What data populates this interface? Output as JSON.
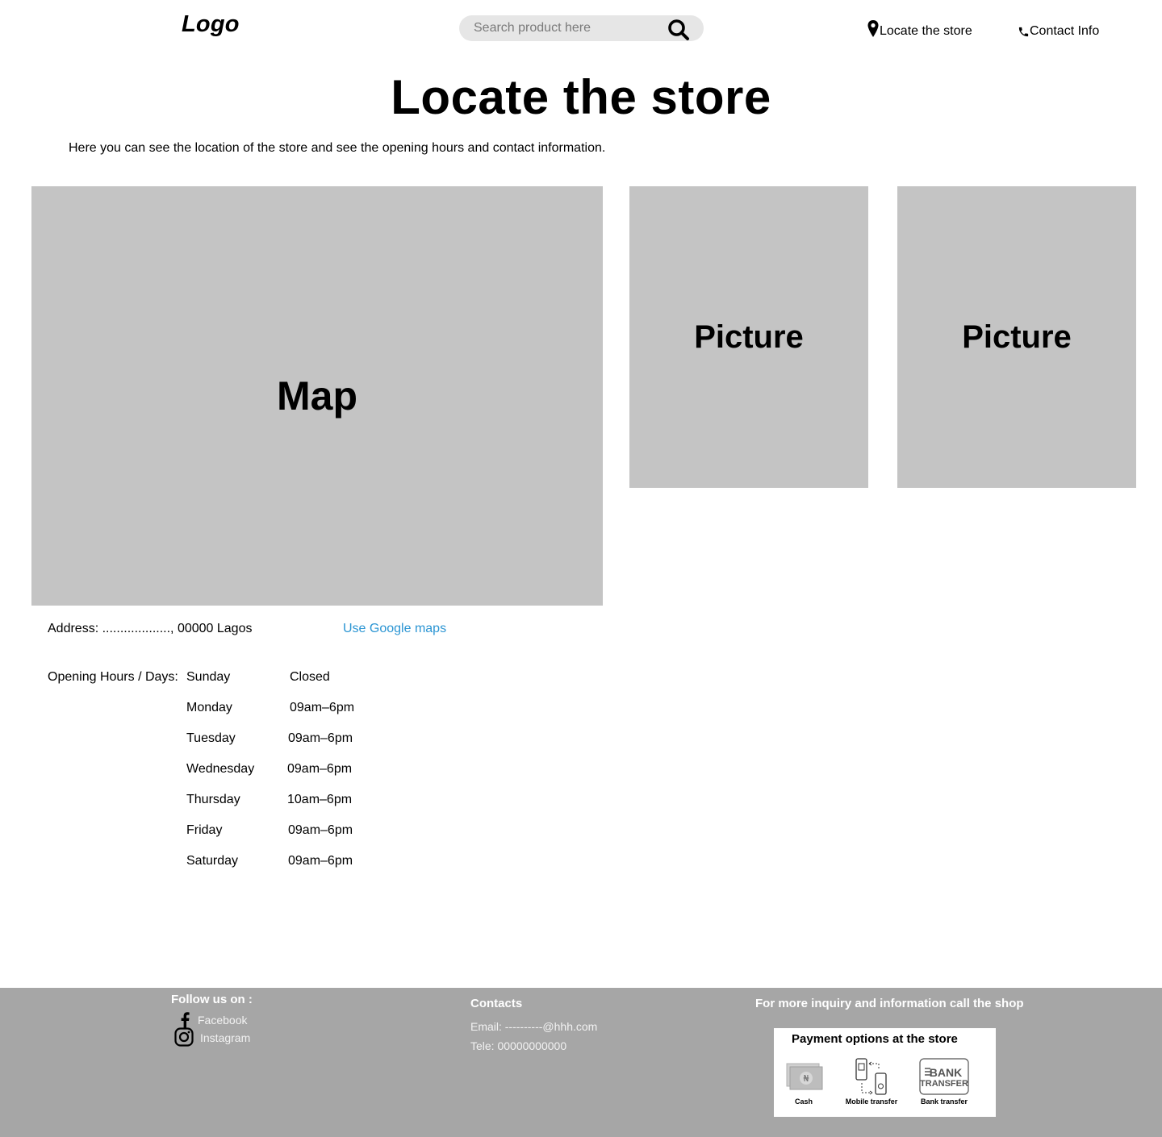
{
  "header": {
    "logo": "Logo",
    "search_placeholder": "Search product here",
    "nav": {
      "locate": "Locate the store",
      "contact": "Contact Info"
    }
  },
  "main": {
    "title": "Locate the store",
    "intro": "Here you can see the location of the store and see the opening hours and contact information.",
    "map_label": "Map",
    "picture_labels": [
      "Picture",
      "Picture"
    ],
    "address": "Address: ..................., 00000 Lagos",
    "google_maps_link": "Use Google maps",
    "hours_label": "Opening Hours / Days:",
    "hours": [
      {
        "day": "Sunday",
        "time": "Closed"
      },
      {
        "day": "Monday",
        "time": "09am–6pm"
      },
      {
        "day": "Tuesday",
        "time": "09am–6pm"
      },
      {
        "day": "Wednesday",
        "time": "09am–6pm"
      },
      {
        "day": "Thursday",
        "time": "10am–6pm"
      },
      {
        "day": "Friday",
        "time": "09am–6pm"
      },
      {
        "day": "Saturday",
        "time": "09am–6pm"
      }
    ]
  },
  "footer": {
    "follow_heading": "Follow us on :",
    "facebook": "Facebook",
    "instagram": "Instagram",
    "contacts_heading": "Contacts",
    "email": "Email: ----------@hhh.com",
    "tele": "Tele: 00000000000",
    "inquiry": "For more inquiry and information call the shop",
    "payment": {
      "title": "Payment options at the store",
      "options": [
        "Cash",
        "Mobile transfer",
        "Bank transfer"
      ],
      "bank_icon_text": [
        "BANK",
        "TRANSFER"
      ],
      "cash_symbol": "₦"
    }
  },
  "colors": {
    "placeholder": "#c4c4c4",
    "footer": "#a6a6a6",
    "link": "#2b95d3",
    "search_bg": "#e6e6e6"
  }
}
